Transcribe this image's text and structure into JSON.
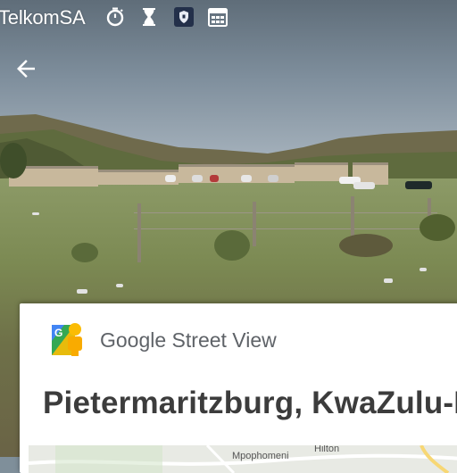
{
  "status_bar": {
    "carrier": "TelkomSA",
    "icons": [
      "stopwatch-icon",
      "hourglass-icon",
      "shield-app-icon",
      "calendar-icon"
    ]
  },
  "back_button": {
    "icon": "back-arrow-icon"
  },
  "card": {
    "app_name": "Google Street View",
    "app_icon": "street-view-pegman-icon",
    "place_title": "Pietermaritzburg, KwaZulu-N",
    "map": {
      "labels": [
        "Hilton",
        "Mpophomeni"
      ]
    }
  },
  "colors": {
    "status_text": "#ffffff",
    "title_text": "#3c3c3c",
    "app_name_text": "#5f6368",
    "card_background": "#ffffff"
  }
}
